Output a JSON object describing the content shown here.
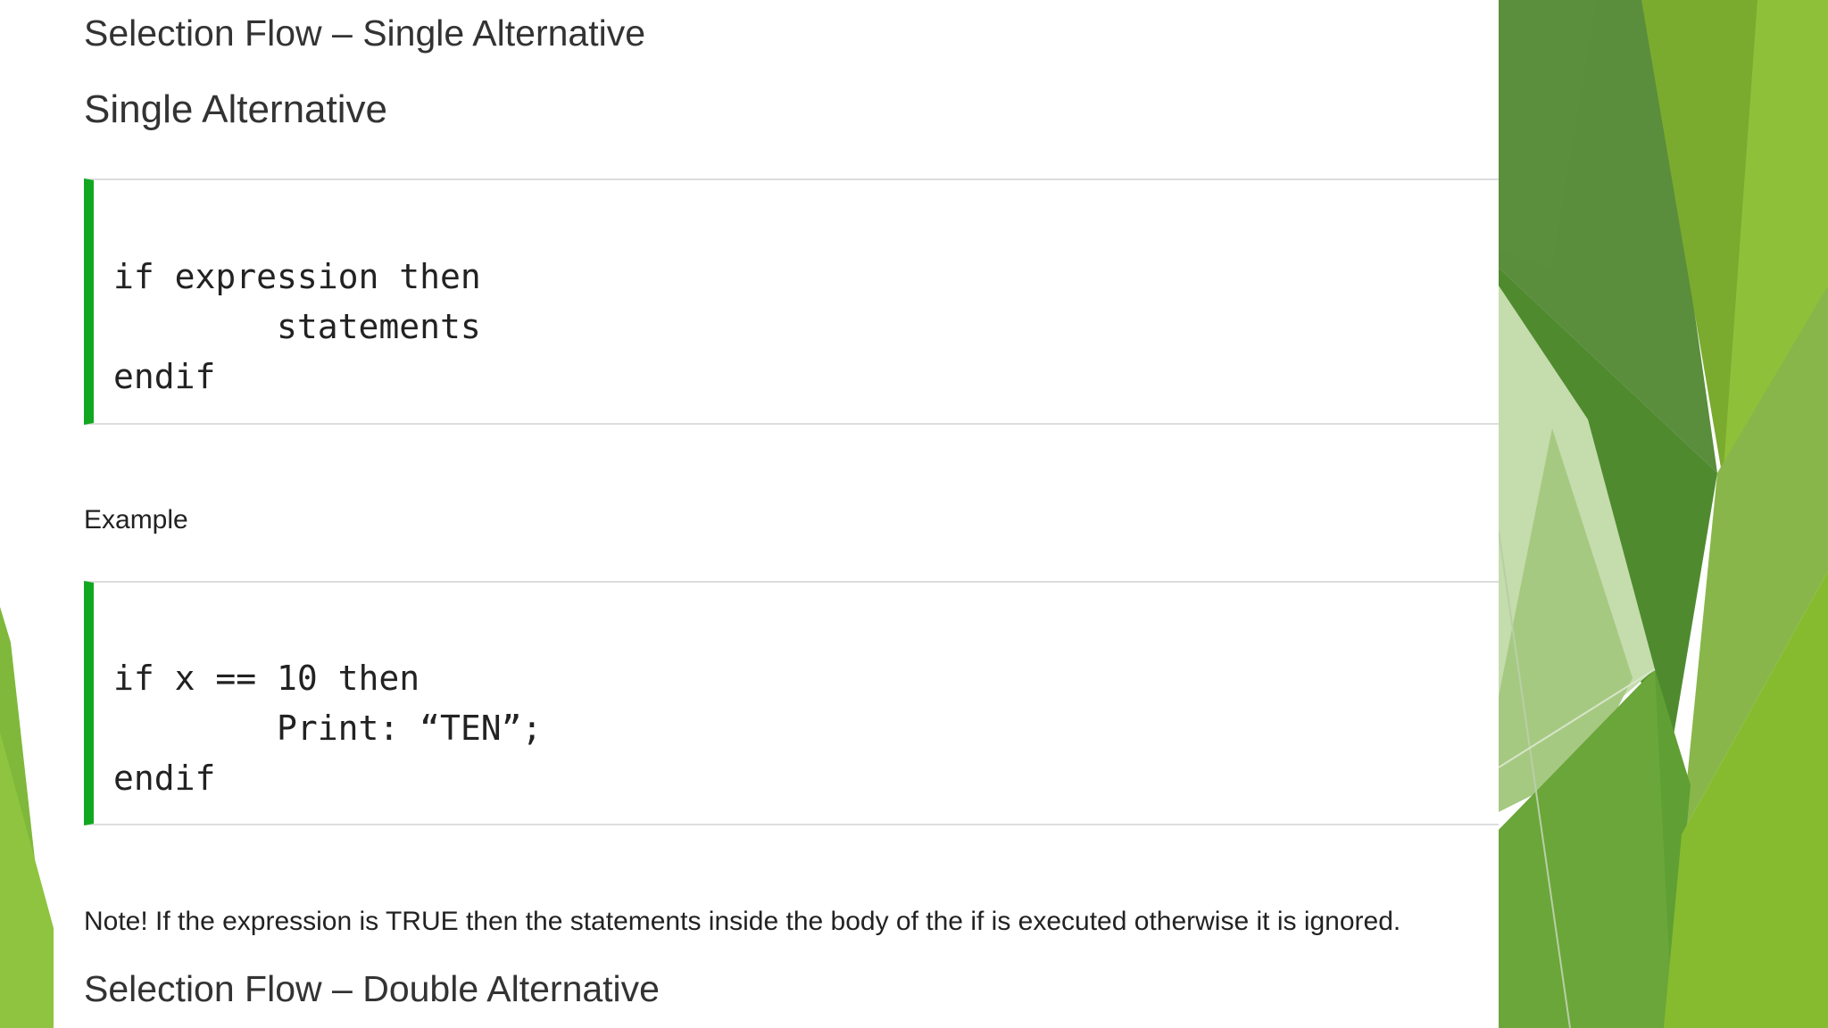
{
  "slide": {
    "title": "Selection Flow – Single Alternative",
    "subtitle": "Single Alternative",
    "syntax_code": [
      "if expression then",
      "        statements",
      "endif"
    ],
    "example_label": "Example",
    "example_code": [
      "if x == 10 then",
      "        Print: “TEN”;",
      "endif"
    ],
    "note": "Note! If the expression is TRUE then the statements inside the body of the if is executed otherwise it is ignored.",
    "next_heading": "Selection Flow – Double Alternative"
  },
  "theme": {
    "accent": "#11a820",
    "green_dark": "#4e8a35",
    "green_mid": "#6fa62f",
    "green_light": "#8dbf3a",
    "green_pale": "#c9dfb0"
  }
}
